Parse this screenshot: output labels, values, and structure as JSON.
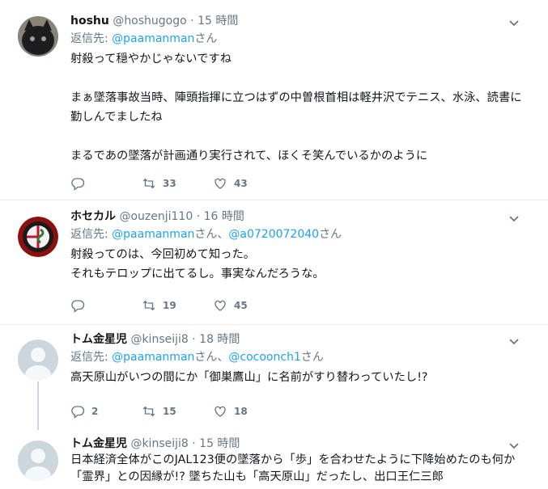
{
  "tweets": [
    {
      "name": "hoshu",
      "handle": "@hoshugogo",
      "time": "15 時間",
      "reply_prefix": "返信先: ",
      "reply_to": [
        "@paamanman"
      ],
      "reply_suffix": "さん",
      "text": "射殺って穏やかじゃないですね\n\nまぁ墜落事故当時、陣頭指揮に立つはずの中曽根首相は軽井沢でテニス、水泳、読書に勤しんでましたね\n\nまるであの墜落が計画通り実行されて、ほくそ笑んでいるかのように",
      "replies": "",
      "retweets": "33",
      "likes": "43"
    },
    {
      "name": "ホセカル",
      "handle": "@ouzenji110",
      "time": "16 時間",
      "reply_prefix": "返信先: ",
      "reply_to": [
        "@paamanman",
        "@a0720072040"
      ],
      "text": "射殺ってのは、今回初めて知った。\nそれもテロップに出てるし。事実なんだろうな。",
      "replies": "",
      "retweets": "19",
      "likes": "45"
    },
    {
      "name": "トム金星児",
      "handle": "@kinseiji8",
      "time": "18 時間",
      "reply_prefix": "返信先: ",
      "reply_to": [
        "@paamanman",
        "@cocoonch1"
      ],
      "text": "高天原山がいつの間にか「御巣鷹山」に名前がすり替わっていたし!?",
      "replies": "2",
      "retweets": "15",
      "likes": "18"
    },
    {
      "name": "トム金星児",
      "handle": "@kinseiji8",
      "time": "15 時間",
      "text": "日本経済全体がこのJAL123便の墜落から「歩」を合わせたように下降始めたのも何か「霊界」との因縁が!? 墜ちた山も「高天原山」だったし、出口王仁三郎"
    }
  ],
  "labels": {
    "san": "さん",
    "sep": "、",
    "dot": " · "
  },
  "colors": {
    "link": "#1da1f2",
    "muted": "#657786",
    "border": "#e6ecf0"
  }
}
